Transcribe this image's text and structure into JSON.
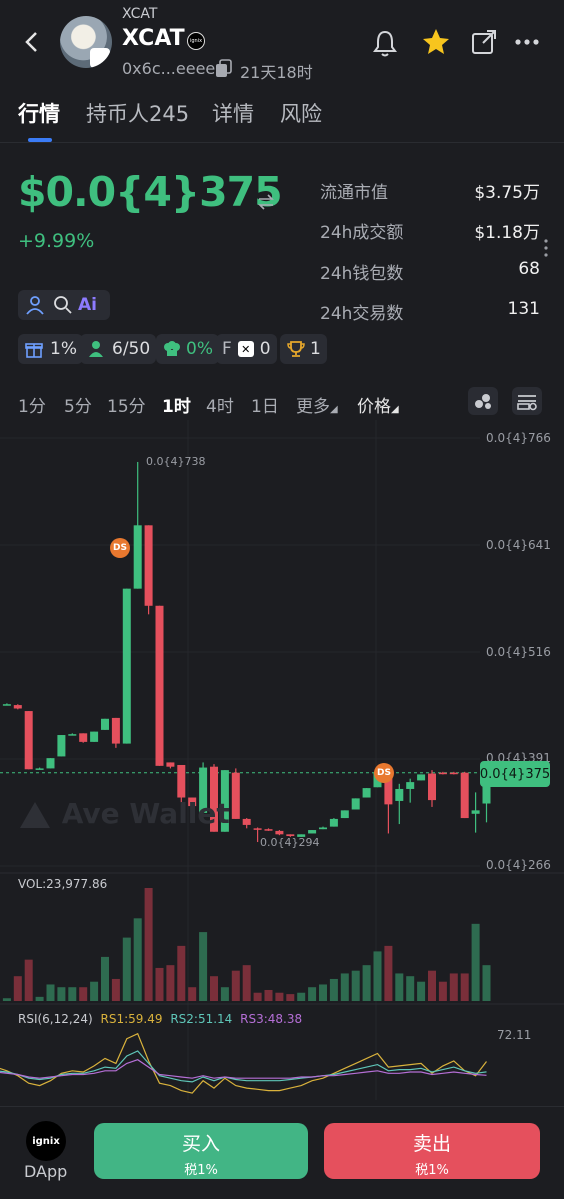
{
  "header": {
    "subtitle": "XCAT",
    "title": "XCAT",
    "address": "0x6c...eeee",
    "age": "21天18时",
    "badge_text": "ignix"
  },
  "tabs": [
    {
      "label": "行情",
      "active": true
    },
    {
      "label": "持币人245",
      "active": false
    },
    {
      "label": "详情",
      "active": false
    },
    {
      "label": "风险",
      "active": false
    }
  ],
  "price": {
    "value": "$0.0{4}375",
    "change": "+9.99%"
  },
  "stats": [
    {
      "label": "流通市值",
      "value": "$3.75万"
    },
    {
      "label": "24h成交额",
      "value": "$1.18万"
    },
    {
      "label": "24h钱包数",
      "value": "68"
    },
    {
      "label": "24h交易数",
      "value": "131"
    }
  ],
  "chips": {
    "gift": "1%",
    "holders": "6/50",
    "chef": "0%",
    "f_label": "F",
    "f_value": "0",
    "trophy": "1"
  },
  "timeframes": [
    {
      "label": "1分",
      "active": false
    },
    {
      "label": "5分",
      "active": false
    },
    {
      "label": "15分",
      "active": false
    },
    {
      "label": "1时",
      "active": true
    },
    {
      "label": "4时",
      "active": false
    },
    {
      "label": "1日",
      "active": false
    },
    {
      "label": "更多",
      "active": false
    },
    {
      "label": "价格",
      "active": true
    }
  ],
  "chart": {
    "y_axis_labels": [
      "0.0{4}766",
      "0.0{4}641",
      "0.0{4}516",
      "0.0{4}391",
      "0.0{4}266"
    ],
    "current_price_label": "0.0{4}375",
    "high_label": "0.0{4}738",
    "low_label": "0.0{4}294",
    "ds_marker": "DS",
    "watermark": "Ave Wallet",
    "vol_label": "VOL:23,977.86",
    "rsi_label": "RSI(6,12,24)",
    "rs1": "RS1:59.49",
    "rs2": "RS2:51.14",
    "rs3": "RS3:48.38",
    "rsi_axis": "72.11",
    "colors": {
      "up": "#3fbf7f",
      "down": "#e5505d",
      "rs1": "#d9b23c",
      "rs2": "#5fc6b8",
      "rs3": "#b56fd6"
    }
  },
  "chart_data": {
    "type": "candlestick",
    "title": "",
    "xlabel": "",
    "ylabel": "",
    "ylim": [
      2.66e-05,
      7.66e-05
    ],
    "candles": [
      {
        "o": 4.56e-05,
        "c": 4.56e-05,
        "h": 4.58e-05,
        "l": 4.55e-05,
        "v": 100
      },
      {
        "o": 4.55e-05,
        "c": 4.55e-05,
        "h": 4.56e-05,
        "l": 4.54e-05,
        "v": 100
      },
      {
        "o": 4.54e-05,
        "c": 4.5e-05,
        "h": 4.55e-05,
        "l": 4.49e-05,
        "v": 900
      },
      {
        "o": 4.47e-05,
        "c": 3.79e-05,
        "h": 4.47e-05,
        "l": 3.79e-05,
        "v": 1500
      },
      {
        "o": 3.8e-05,
        "c": 3.8e-05,
        "h": 3.81e-05,
        "l": 3.79e-05,
        "v": 150
      },
      {
        "o": 3.8e-05,
        "c": 3.92e-05,
        "h": 3.92e-05,
        "l": 3.8e-05,
        "v": 600
      },
      {
        "o": 3.94e-05,
        "c": 4.19e-05,
        "h": 4.19e-05,
        "l": 3.94e-05,
        "v": 500
      },
      {
        "o": 4.2e-05,
        "c": 4.2e-05,
        "h": 4.21e-05,
        "l": 4.19e-05,
        "v": 500
      },
      {
        "o": 4.21e-05,
        "c": 4.11e-05,
        "h": 4.21e-05,
        "l": 4.1e-05,
        "v": 500
      },
      {
        "o": 4.11e-05,
        "c": 4.23e-05,
        "h": 4.23e-05,
        "l": 4.11e-05,
        "v": 700
      },
      {
        "o": 4.25e-05,
        "c": 4.38e-05,
        "h": 4.38e-05,
        "l": 4.25e-05,
        "v": 1600
      },
      {
        "o": 4.39e-05,
        "c": 4.09e-05,
        "h": 4.39e-05,
        "l": 4.04e-05,
        "v": 800
      },
      {
        "o": 4.09e-05,
        "c": 5.9e-05,
        "h": 5.9e-05,
        "l": 4.09e-05,
        "v": 2300
      },
      {
        "o": 5.9e-05,
        "c": 6.64e-05,
        "h": 7.38e-05,
        "l": 5.9e-05,
        "v": 3000
      },
      {
        "o": 6.64e-05,
        "c": 5.7e-05,
        "h": 6.64e-05,
        "l": 5.6e-05,
        "v": 4100
      },
      {
        "o": 5.7e-05,
        "c": 3.83e-05,
        "h": 5.7e-05,
        "l": 3.83e-05,
        "v": 1200
      },
      {
        "o": 3.87e-05,
        "c": 3.82e-05,
        "h": 3.87e-05,
        "l": 3.8e-05,
        "v": 1300
      },
      {
        "o": 3.84e-05,
        "c": 3.46e-05,
        "h": 3.84e-05,
        "l": 3.4e-05,
        "v": 2000
      },
      {
        "o": 3.46e-05,
        "c": 3.36e-05,
        "h": 3.46e-05,
        "l": 3.36e-05,
        "v": 500
      },
      {
        "o": 3.28e-05,
        "c": 3.81e-05,
        "h": 3.87e-05,
        "l": 3.28e-05,
        "v": 2500
      },
      {
        "o": 3.82e-05,
        "c": 3.06e-05,
        "h": 3.85e-05,
        "l": 3.06e-05,
        "v": 900
      },
      {
        "o": 3.06e-05,
        "c": 3.78e-05,
        "h": 3.78e-05,
        "l": 3.06e-05,
        "v": 500
      },
      {
        "o": 3.75e-05,
        "c": 3.21e-05,
        "h": 3.8e-05,
        "l": 3.21e-05,
        "v": 1100
      },
      {
        "o": 3.21e-05,
        "c": 3.14e-05,
        "h": 3.22e-05,
        "l": 3.1e-05,
        "v": 1300
      },
      {
        "o": 3.1e-05,
        "c": 3.09e-05,
        "h": 3.11e-05,
        "l": 2.94e-05,
        "v": 300
      },
      {
        "o": 3.09e-05,
        "c": 3.08e-05,
        "h": 3.1e-05,
        "l": 3.07e-05,
        "v": 400
      },
      {
        "o": 3.07e-05,
        "c": 3.03e-05,
        "h": 3.08e-05,
        "l": 3.02e-05,
        "v": 300
      },
      {
        "o": 3.03e-05,
        "c": 3.01e-05,
        "h": 3.03e-05,
        "l": 3e-05,
        "v": 250
      },
      {
        "o": 3e-05,
        "c": 3.03e-05,
        "h": 3.03e-05,
        "l": 3e-05,
        "v": 300
      },
      {
        "o": 3.04e-05,
        "c": 3.08e-05,
        "h": 3.08e-05,
        "l": 3.04e-05,
        "v": 500
      },
      {
        "o": 3.09e-05,
        "c": 3.11e-05,
        "h": 3.12e-05,
        "l": 3.09e-05,
        "v": 600
      },
      {
        "o": 3.12e-05,
        "c": 3.21e-05,
        "h": 3.22e-05,
        "l": 3.12e-05,
        "v": 800
      },
      {
        "o": 3.22e-05,
        "c": 3.31e-05,
        "h": 3.31e-05,
        "l": 3.22e-05,
        "v": 1000
      },
      {
        "o": 3.32e-05,
        "c": 3.45e-05,
        "h": 3.45e-05,
        "l": 3.32e-05,
        "v": 1100
      },
      {
        "o": 3.46e-05,
        "c": 3.57e-05,
        "h": 3.57e-05,
        "l": 3.46e-05,
        "v": 1300
      },
      {
        "o": 3.58e-05,
        "c": 3.75e-05,
        "h": 3.76e-05,
        "l": 3.58e-05,
        "v": 1800
      },
      {
        "o": 3.75e-05,
        "c": 3.38e-05,
        "h": 3.78e-05,
        "l": 3.04e-05,
        "v": 2000
      },
      {
        "o": 3.42e-05,
        "c": 3.56e-05,
        "h": 3.62e-05,
        "l": 3.15e-05,
        "v": 1000
      },
      {
        "o": 3.56e-05,
        "c": 3.64e-05,
        "h": 3.68e-05,
        "l": 3.4e-05,
        "v": 900
      },
      {
        "o": 3.66e-05,
        "c": 3.73e-05,
        "h": 3.73e-05,
        "l": 3.66e-05,
        "v": 700
      },
      {
        "o": 3.74e-05,
        "c": 3.43e-05,
        "h": 3.78e-05,
        "l": 3.35e-05,
        "v": 1100
      },
      {
        "o": 3.75e-05,
        "c": 3.74e-05,
        "h": 3.76e-05,
        "l": 3.73e-05,
        "v": 700
      },
      {
        "o": 3.75e-05,
        "c": 3.74e-05,
        "h": 3.76e-05,
        "l": 3.73e-05,
        "v": 1000
      },
      {
        "o": 3.75e-05,
        "c": 3.22e-05,
        "h": 3.76e-05,
        "l": 3.22e-05,
        "v": 1000
      },
      {
        "o": 3.27e-05,
        "c": 3.31e-05,
        "h": 3.52e-05,
        "l": 3.05e-05,
        "v": 2800
      },
      {
        "o": 3.39e-05,
        "c": 3.75e-05,
        "h": 3.75e-05,
        "l": 3.17e-05,
        "v": 1300
      }
    ],
    "rsi": {
      "rs1": [
        55,
        52,
        48,
        42,
        40,
        44,
        50,
        52,
        51,
        56,
        62,
        58,
        78,
        82,
        60,
        42,
        40,
        36,
        34,
        44,
        38,
        46,
        40,
        38,
        37,
        36,
        36,
        38,
        40,
        44,
        46,
        50,
        54,
        58,
        62,
        66,
        55,
        56,
        57,
        58,
        50,
        56,
        60,
        52,
        48,
        59.49
      ],
      "rs2": [
        52,
        51,
        49,
        46,
        45,
        46,
        49,
        50,
        50,
        52,
        55,
        54,
        64,
        68,
        58,
        48,
        46,
        44,
        43,
        47,
        44,
        47,
        45,
        44,
        44,
        44,
        44,
        45,
        46,
        47,
        48,
        49,
        51,
        53,
        55,
        57,
        52,
        53,
        53,
        54,
        51,
        53,
        55,
        52,
        50,
        51.14
      ],
      "rs3": [
        51,
        50,
        49,
        47,
        46,
        47,
        48,
        49,
        49,
        50,
        52,
        52,
        58,
        61,
        55,
        49,
        48,
        47,
        46,
        48,
        46,
        47,
        46,
        46,
        46,
        46,
        46,
        46,
        47,
        47,
        48,
        48,
        49,
        50,
        51,
        52,
        50,
        50,
        51,
        51,
        49,
        50,
        51,
        50,
        49,
        48.38
      ]
    }
  },
  "bottom": {
    "dapp_logo": "ignix",
    "dapp_label": "DApp",
    "buy_label": "买入",
    "buy_tax": "税1%",
    "sell_label": "卖出",
    "sell_tax": "税1%"
  }
}
